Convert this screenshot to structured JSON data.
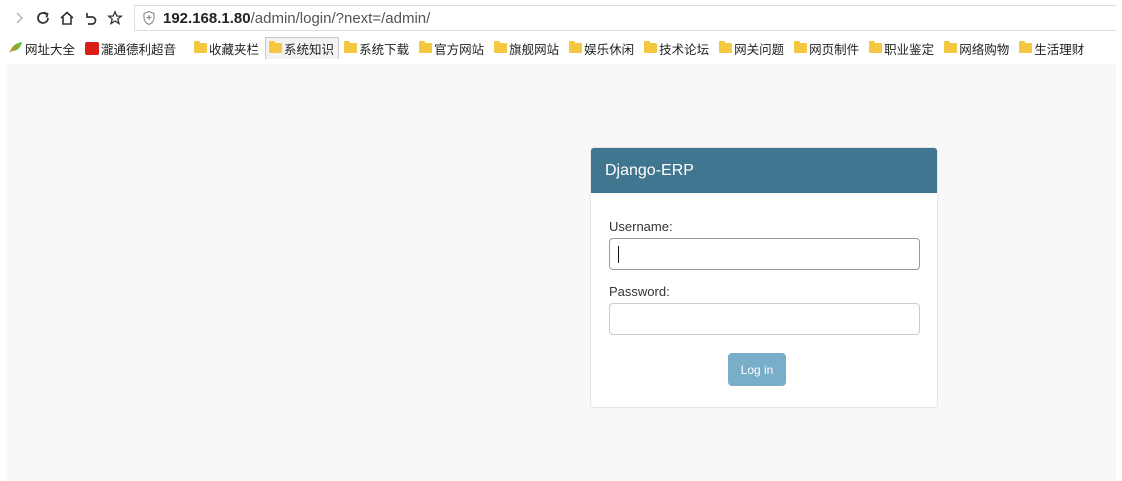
{
  "address_bar": {
    "url_host": "192.168.1.80",
    "url_path": "/admin/login/?next=/admin/"
  },
  "bookmarks": [
    {
      "label": "网址大全",
      "icon": "leaf-icon"
    },
    {
      "label": "瀧通德利超音",
      "icon": "red-square-icon"
    },
    {
      "label": "收藏夹栏",
      "icon": "folder-icon"
    },
    {
      "label": "系统知识",
      "icon": "folder-icon",
      "active": true
    },
    {
      "label": "系统下载",
      "icon": "folder-icon"
    },
    {
      "label": "官方网站",
      "icon": "folder-icon"
    },
    {
      "label": "旗舰网站",
      "icon": "folder-icon"
    },
    {
      "label": "娱乐休闲",
      "icon": "folder-icon"
    },
    {
      "label": "技术论坛",
      "icon": "folder-icon"
    },
    {
      "label": "网关问题",
      "icon": "folder-icon"
    },
    {
      "label": "网页制件",
      "icon": "folder-icon"
    },
    {
      "label": "职业鉴定",
      "icon": "folder-icon"
    },
    {
      "label": "网络购物",
      "icon": "folder-icon"
    },
    {
      "label": "生活理财",
      "icon": "folder-icon"
    }
  ],
  "login": {
    "site_title": "Django-ERP",
    "username_label": "Username:",
    "username_value": "",
    "password_label": "Password:",
    "password_value": "",
    "submit_label": "Log in"
  },
  "colors": {
    "header_bg": "#417690",
    "button_bg": "#79aec8",
    "page_bg": "#f8f8f8"
  }
}
